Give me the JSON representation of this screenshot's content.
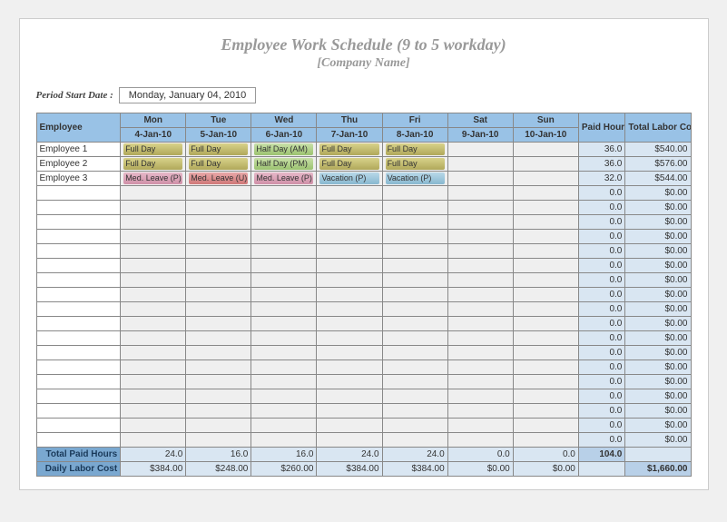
{
  "title": "Employee Work Schedule (9 to 5 workday)",
  "subtitle": "[Company Name]",
  "period_label": "Period Start Date :",
  "period_value": "Monday, January 04, 2010",
  "headers": {
    "employee": "Employee",
    "days": [
      {
        "dow": "Mon",
        "date": "4-Jan-10"
      },
      {
        "dow": "Tue",
        "date": "5-Jan-10"
      },
      {
        "dow": "Wed",
        "date": "6-Jan-10"
      },
      {
        "dow": "Thu",
        "date": "7-Jan-10"
      },
      {
        "dow": "Fri",
        "date": "8-Jan-10"
      },
      {
        "dow": "Sat",
        "date": "9-Jan-10"
      },
      {
        "dow": "Sun",
        "date": "10-Jan-10"
      }
    ],
    "paid_hours": "Paid Hours",
    "total_labor": "Total Labor Cost"
  },
  "rows": [
    {
      "emp": "Employee 1",
      "cells": [
        {
          "t": "Full Day",
          "c": "full"
        },
        {
          "t": "Full Day",
          "c": "full"
        },
        {
          "t": "Half Day (AM)",
          "c": "half"
        },
        {
          "t": "Full Day",
          "c": "full"
        },
        {
          "t": "Full Day",
          "c": "full"
        },
        {
          "t": "",
          "c": ""
        },
        {
          "t": "",
          "c": ""
        }
      ],
      "paid": "36.0",
      "total": "$540.00"
    },
    {
      "emp": "Employee 2",
      "cells": [
        {
          "t": "Full Day",
          "c": "full"
        },
        {
          "t": "Full Day",
          "c": "full"
        },
        {
          "t": "Half Day (PM)",
          "c": "half"
        },
        {
          "t": "Full Day",
          "c": "full"
        },
        {
          "t": "Full Day",
          "c": "full"
        },
        {
          "t": "",
          "c": ""
        },
        {
          "t": "",
          "c": ""
        }
      ],
      "paid": "36.0",
      "total": "$576.00"
    },
    {
      "emp": "Employee 3",
      "cells": [
        {
          "t": "Med. Leave (P)",
          "c": "medp"
        },
        {
          "t": "Med. Leave (U)",
          "c": "medu",
          "dd": true
        },
        {
          "t": "Med. Leave (P)",
          "c": "medp"
        },
        {
          "t": "Vacation (P)",
          "c": "vac"
        },
        {
          "t": "Vacation (P)",
          "c": "vac"
        },
        {
          "t": "",
          "c": ""
        },
        {
          "t": "",
          "c": ""
        }
      ],
      "paid": "32.0",
      "total": "$544.00"
    }
  ],
  "empty_row": {
    "paid": "0.0",
    "total": "$0.00"
  },
  "empty_count": 18,
  "totals": {
    "paid_label": "Total Paid Hours",
    "paid_days": [
      "24.0",
      "16.0",
      "16.0",
      "24.0",
      "24.0",
      "0.0",
      "0.0"
    ],
    "paid_sum": "104.0",
    "cost_label": "Daily Labor Cost",
    "cost_days": [
      "$384.00",
      "$248.00",
      "$260.00",
      "$384.00",
      "$384.00",
      "$0.00",
      "$0.00"
    ],
    "cost_sum": "$1,660.00"
  }
}
